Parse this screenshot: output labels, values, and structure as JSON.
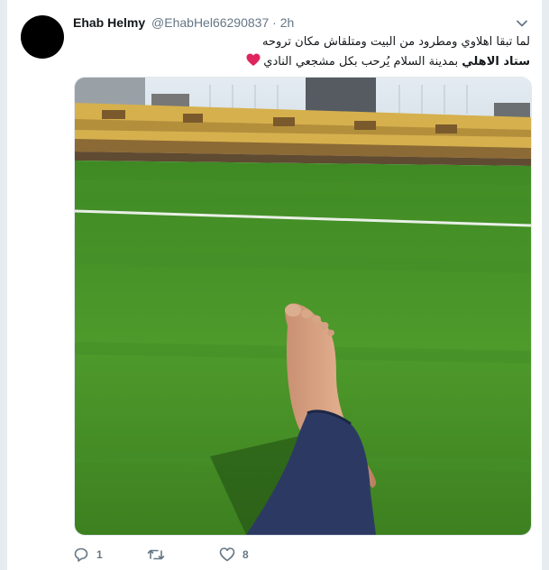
{
  "tweet": {
    "author_name": "Ehab Helmy",
    "handle": "@EhabHel66290837",
    "separator": "·",
    "time": "2h",
    "line1": "لما تبقا اهلاوي ومطرود من البيت ومتلقاش مكان تروحه",
    "line2_bold": "ستاد الاهلي",
    "line2_rest": " بمدينة السلام يُرحب بكل مشجعي النادي",
    "emoji_name": "red-heart-icon",
    "media_description_icon": "stadium-photo"
  },
  "actions": {
    "reply_count": "1",
    "retweet_count": "",
    "like_count": "8"
  },
  "colors": {
    "text": "#14171a",
    "muted": "#657786",
    "heart": "#e0245e",
    "background": "#e6ecf0"
  }
}
